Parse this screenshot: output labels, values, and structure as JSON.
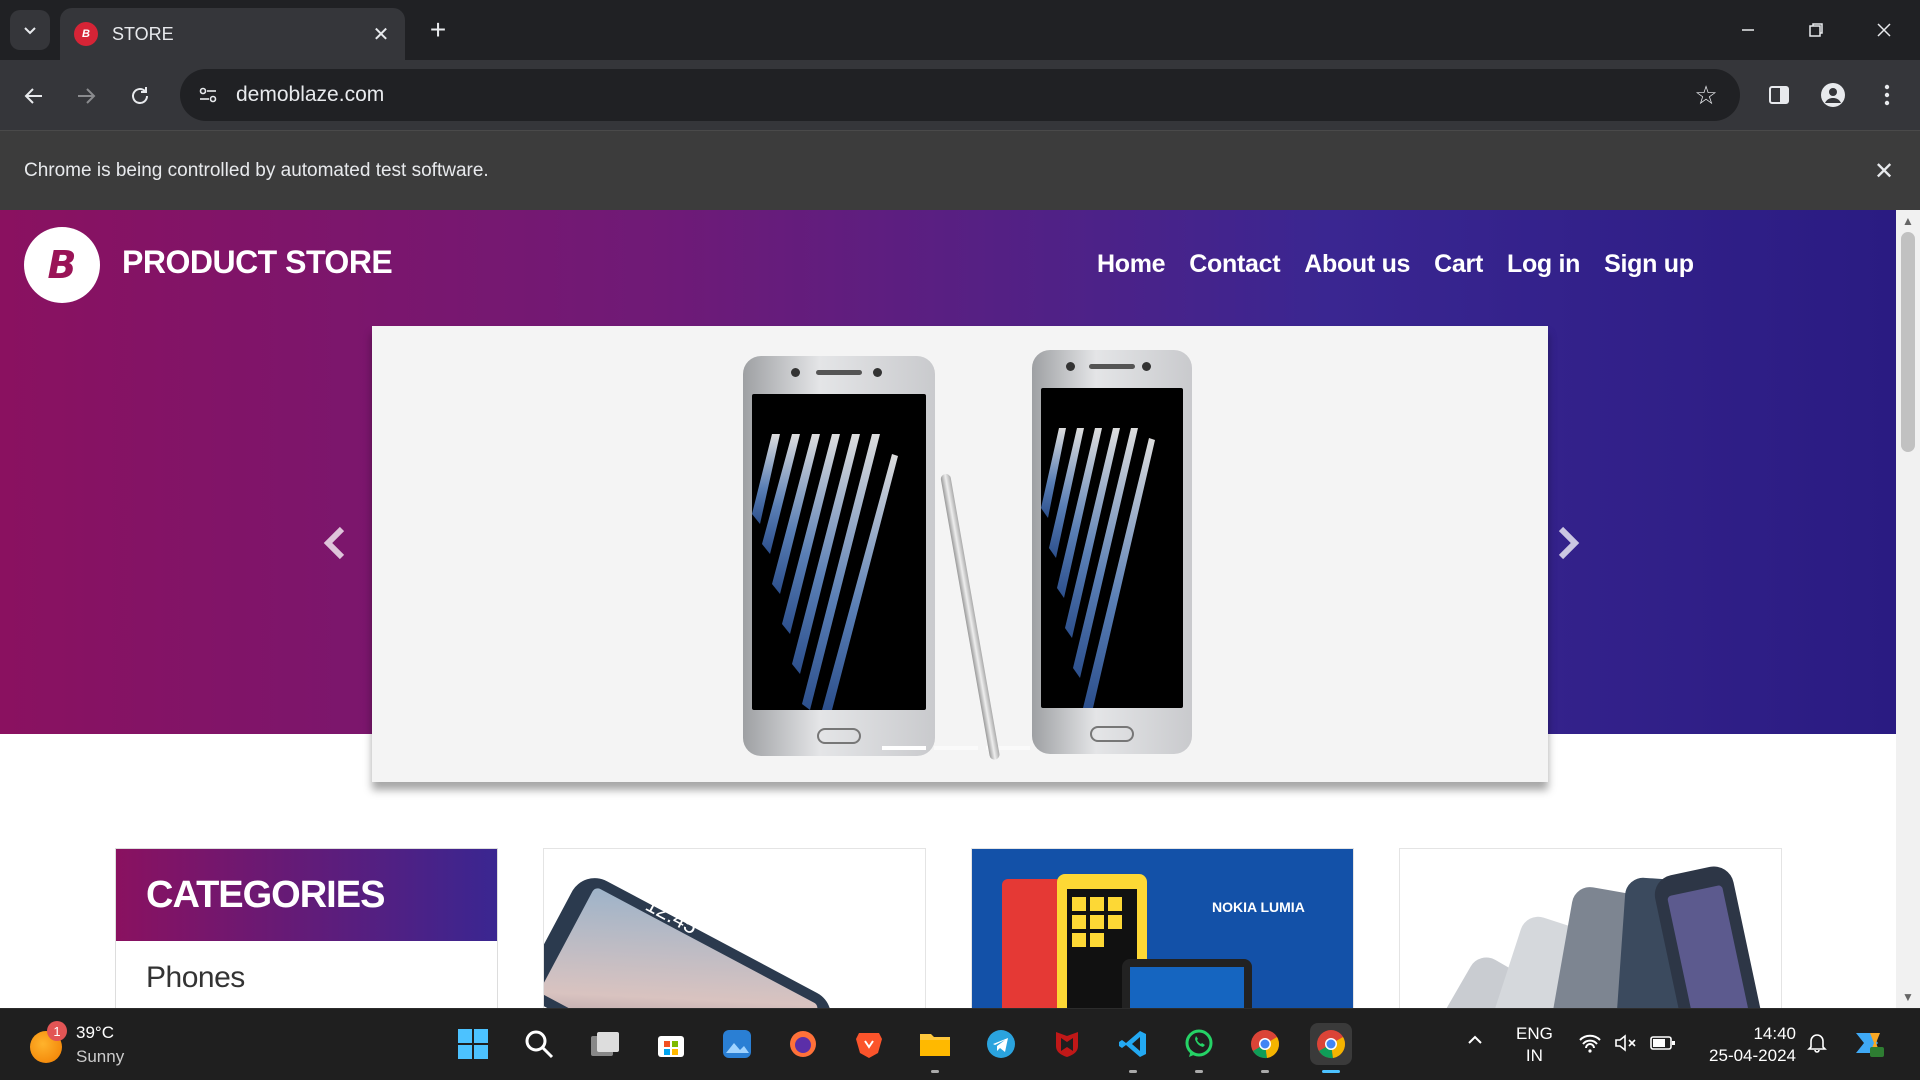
{
  "browser": {
    "tab_title": "STORE",
    "tab_favicon_text": "B",
    "url": "demoblaze.com",
    "infobar_text": "Chrome is being controlled by automated test software."
  },
  "site": {
    "brand": "PRODUCT STORE",
    "logo_letter": "B",
    "nav": [
      "Home",
      "Contact",
      "About us",
      "Cart",
      "Log in",
      "Sign up"
    ],
    "carousel": {
      "slides": 3,
      "active": 1,
      "prev_icon": "chevron-left-icon",
      "next_icon": "chevron-right-icon"
    },
    "categories_title": "CATEGORIES",
    "categories": [
      "Phones"
    ],
    "cards": [
      {
        "image": "samsung-galaxy-s6-image"
      },
      {
        "image": "nokia-lumia-image",
        "label": "NOKIA LUMIA"
      },
      {
        "image": "nexus-6-image"
      }
    ]
  },
  "taskbar": {
    "weather_temp": "39°C",
    "weather_cond": "Sunny",
    "weather_badge": "1",
    "lang_top": "ENG",
    "lang_bottom": "IN",
    "time": "14:40",
    "date": "25-04-2024",
    "apps": [
      "start",
      "search",
      "task-view",
      "store",
      "photos",
      "firefox",
      "brave",
      "file-explorer",
      "telegram",
      "mcafee",
      "vscode",
      "whatsapp",
      "chrome",
      "chrome-active"
    ]
  },
  "colors": {
    "hero_start": "#8a1160",
    "hero_end": "#2a1b82",
    "chrome_bg": "#202124",
    "toolbar_bg": "#35363a"
  }
}
